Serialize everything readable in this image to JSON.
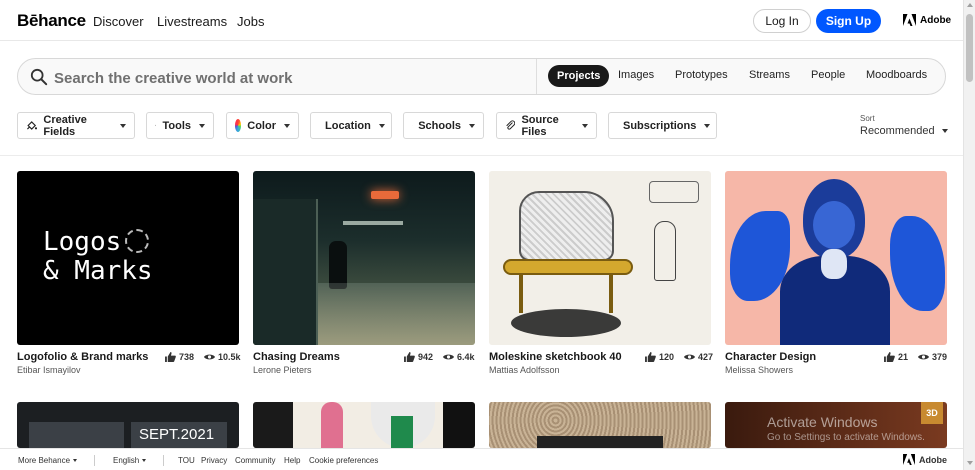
{
  "header": {
    "logo": "Bēhance",
    "nav": [
      "Discover",
      "Livestreams",
      "Jobs"
    ],
    "login_label": "Log In",
    "signup_label": "Sign Up",
    "adobe_label": "Adobe"
  },
  "search": {
    "placeholder": "Search the creative world at work",
    "tabs": [
      "Projects",
      "Images",
      "Prototypes",
      "Streams",
      "People",
      "Moodboards"
    ],
    "active_tab": "Projects"
  },
  "filters": [
    "Creative Fields",
    "Tools",
    "Color",
    "Location",
    "Schools",
    "Source Files",
    "Subscriptions"
  ],
  "sort": {
    "label": "Sort",
    "value": "Recommended"
  },
  "projects": [
    {
      "title": "Logofolio & Brand marks",
      "owner": "Etibar Ismayilov",
      "likes": "738",
      "views": "10.5k",
      "art_text_1": "Logos",
      "art_text_2": "& Marks"
    },
    {
      "title": "Chasing Dreams",
      "owner": "Lerone Pieters",
      "likes": "942",
      "views": "6.4k"
    },
    {
      "title": "Moleskine sketchbook 40",
      "owner": "Mattias Adolfsson",
      "likes": "120",
      "views": "427"
    },
    {
      "title": "Character Design",
      "owner": "Melissa Showers",
      "likes": "21",
      "views": "379"
    }
  ],
  "row2": {
    "sept_text": "SEPT.2021",
    "badge": "3D",
    "overlay_title": "Activate Windows",
    "overlay_sub": "Go to Settings to activate Windows."
  },
  "footer": {
    "more": "More Behance",
    "language": "English",
    "links": [
      "TOU",
      "Privacy",
      "Community",
      "Help",
      "Cookie preferences"
    ],
    "adobe": "Adobe"
  },
  "colors": {
    "accent": "#0057ff",
    "dark": "#191919"
  }
}
